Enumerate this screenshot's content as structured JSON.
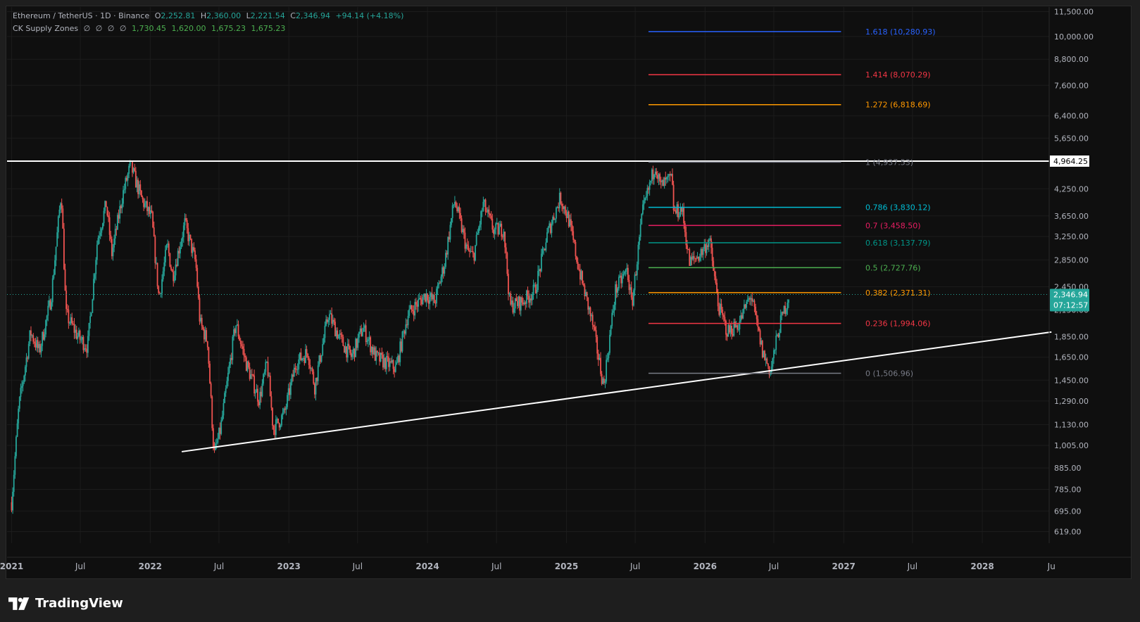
{
  "header": {
    "symbol": "Ethereum / TetherUS · 1D · Binance",
    "open_label": "O",
    "open": "2,252.81",
    "high_label": "H",
    "high": "2,360.00",
    "low_label": "L",
    "low": "2,221.54",
    "close_label": "C",
    "close": "2,346.94",
    "change": "+94.14 (+4.18%)"
  },
  "indicator": {
    "name": "CK Supply Zones",
    "symbols": [
      "∅",
      "∅",
      "∅",
      "∅"
    ],
    "values": [
      "1,730.45",
      "1,620.00",
      "1,675.23",
      "1,675.23"
    ]
  },
  "branding": {
    "name": "TradingView"
  },
  "colors": {
    "background": "#0f0f0f",
    "up": "#26a69a",
    "down": "#ef5350",
    "text": "#b2b5be"
  },
  "chart_data": {
    "type": "candlestick",
    "scale": "log",
    "ylim": [
      580,
      11800
    ],
    "xlim": [
      "2020-12-20",
      "2028-06-25"
    ],
    "y_ticks": [
      "11,500.00",
      "10,000.00",
      "8,800.00",
      "7,600.00",
      "6,400.00",
      "5,650.00",
      "4,250.00",
      "3,650.00",
      "3,250.00",
      "2,850.00",
      "2,450.00",
      "2,150.00",
      "1,850.00",
      "1,650.00",
      "1,450.00",
      "1,290.00",
      "1,130.00",
      "1,005.00",
      "885.00",
      "785.00",
      "695.00",
      "619.00"
    ],
    "x_ticks": [
      {
        "label": "2021",
        "date": "2021-01-01"
      },
      {
        "label": "Jul",
        "date": "2021-07-01"
      },
      {
        "label": "2022",
        "date": "2022-01-01"
      },
      {
        "label": "Jul",
        "date": "2022-07-01"
      },
      {
        "label": "2023",
        "date": "2023-01-01"
      },
      {
        "label": "Jul",
        "date": "2023-07-01"
      },
      {
        "label": "2024",
        "date": "2024-01-01"
      },
      {
        "label": "Jul",
        "date": "2024-07-01"
      },
      {
        "label": "2025",
        "date": "2025-01-01"
      },
      {
        "label": "Jul",
        "date": "2025-07-01"
      },
      {
        "label": "2026",
        "date": "2026-01-01"
      },
      {
        "label": "Jul",
        "date": "2026-07-01"
      },
      {
        "label": "2027",
        "date": "2027-01-01"
      },
      {
        "label": "Jul",
        "date": "2027-07-01"
      },
      {
        "label": "2028",
        "date": "2028-01-01"
      },
      {
        "label": "Ju",
        "date": "2028-07-01"
      }
    ],
    "price_path": [
      [
        "2021-01-01",
        730
      ],
      [
        "2021-01-20",
        1250
      ],
      [
        "2021-02-20",
        1900
      ],
      [
        "2021-03-15",
        1700
      ],
      [
        "2021-04-15",
        2300
      ],
      [
        "2021-05-12",
        4200
      ],
      [
        "2021-05-24",
        2100
      ],
      [
        "2021-06-25",
        1850
      ],
      [
        "2021-07-20",
        1750
      ],
      [
        "2021-08-15",
        3200
      ],
      [
        "2021-09-07",
        3900
      ],
      [
        "2021-09-22",
        2950
      ],
      [
        "2021-10-20",
        4100
      ],
      [
        "2021-11-10",
        4850
      ],
      [
        "2021-12-10",
        4000
      ],
      [
        "2022-01-05",
        3600
      ],
      [
        "2022-01-24",
        2300
      ],
      [
        "2022-02-15",
        3100
      ],
      [
        "2022-03-01",
        2600
      ],
      [
        "2022-04-02",
        3500
      ],
      [
        "2022-05-01",
        2800
      ],
      [
        "2022-05-12",
        2000
      ],
      [
        "2022-06-01",
        1800
      ],
      [
        "2022-06-18",
        950
      ],
      [
        "2022-07-05",
        1100
      ],
      [
        "2022-08-14",
        2000
      ],
      [
        "2022-09-10",
        1600
      ],
      [
        "2022-10-15",
        1300
      ],
      [
        "2022-11-05",
        1600
      ],
      [
        "2022-11-21",
        1100
      ],
      [
        "2022-12-20",
        1200
      ],
      [
        "2023-01-20",
        1600
      ],
      [
        "2023-02-20",
        1700
      ],
      [
        "2023-03-10",
        1400
      ],
      [
        "2023-04-15",
        2100
      ],
      [
        "2023-05-20",
        1800
      ],
      [
        "2023-06-15",
        1650
      ],
      [
        "2023-07-15",
        1950
      ],
      [
        "2023-08-18",
        1650
      ],
      [
        "2023-10-10",
        1550
      ],
      [
        "2023-11-10",
        2100
      ],
      [
        "2023-12-28",
        2350
      ],
      [
        "2024-01-20",
        2250
      ],
      [
        "2024-02-15",
        2800
      ],
      [
        "2024-03-12",
        4000
      ],
      [
        "2024-04-15",
        3000
      ],
      [
        "2024-05-01",
        2900
      ],
      [
        "2024-05-27",
        3900
      ],
      [
        "2024-06-24",
        3350
      ],
      [
        "2024-07-20",
        3400
      ],
      [
        "2024-08-05",
        2200
      ],
      [
        "2024-09-06",
        2250
      ],
      [
        "2024-10-10",
        2400
      ],
      [
        "2024-11-12",
        3300
      ],
      [
        "2024-12-16",
        4050
      ],
      [
        "2025-01-06",
        3600
      ],
      [
        "2025-02-03",
        2700
      ],
      [
        "2025-03-10",
        2000
      ],
      [
        "2025-04-09",
        1400
      ],
      [
        "2025-05-10",
        2400
      ],
      [
        "2025-06-10",
        2700
      ],
      [
        "2025-06-22",
        2200
      ],
      [
        "2025-07-20",
        3700
      ],
      [
        "2025-08-23",
        4900
      ],
      [
        "2025-09-05",
        4300
      ],
      [
        "2025-10-05",
        4500
      ],
      [
        "2025-10-11",
        3700
      ],
      [
        "2025-11-01",
        3800
      ],
      [
        "2025-11-21",
        2800
      ],
      [
        "2025-12-20",
        2950
      ],
      [
        "2026-01-12",
        3200
      ],
      [
        "2026-02-05",
        2200
      ],
      [
        "2026-03-01",
        1900
      ],
      [
        "2026-04-01",
        2000
      ],
      [
        "2026-05-01",
        2350
      ],
      [
        "2026-06-01",
        1700
      ],
      [
        "2026-06-22",
        1520
      ],
      [
        "2026-07-15",
        1950
      ],
      [
        "2026-08-10",
        2346.94
      ]
    ],
    "fib_levels": [
      {
        "ratio": "1.618",
        "value": 10280.93,
        "label": "1.618 (10,280.93)",
        "color": "#2962ff"
      },
      {
        "ratio": "1.414",
        "value": 8070.29,
        "label": "1.414 (8,070.29)",
        "color": "#f23645"
      },
      {
        "ratio": "1.272",
        "value": 6818.69,
        "label": "1.272 (6,818.69)",
        "color": "#ff9800"
      },
      {
        "ratio": "1",
        "value": 4937.53,
        "label": "1 (4,937.53)",
        "color": "#787b86"
      },
      {
        "ratio": "0.786",
        "value": 3830.12,
        "label": "0.786 (3,830.12)",
        "color": "#00bcd4"
      },
      {
        "ratio": "0.7",
        "value": 3458.5,
        "label": "0.7 (3,458.50)",
        "color": "#e91e63"
      },
      {
        "ratio": "0.618",
        "value": 3137.79,
        "label": "0.618 (3,137.79)",
        "color": "#009688"
      },
      {
        "ratio": "0.5",
        "value": 2727.76,
        "label": "0.5 (2,727.76)",
        "color": "#4caf50"
      },
      {
        "ratio": "0.382",
        "value": 2371.31,
        "label": "0.382 (2,371.31)",
        "color": "#ff9800"
      },
      {
        "ratio": "0.236",
        "value": 1994.06,
        "label": "0.236 (1,994.06)",
        "color": "#f23645"
      },
      {
        "ratio": "0",
        "value": 1506.96,
        "label": "0 (1,506.96)",
        "color": "#787b86"
      }
    ],
    "fib_start": "2025-08-05",
    "fib_end": "2026-12-25",
    "resistance_line": {
      "value": 4964.25,
      "label": "4,964.25"
    },
    "trend_line": {
      "from": [
        "2022-03-25",
        970
      ],
      "to": [
        "2028-07-01",
        1900
      ]
    },
    "last_price": {
      "value": 2346.94,
      "label": "2,346.94",
      "countdown": "07:12:57"
    }
  }
}
